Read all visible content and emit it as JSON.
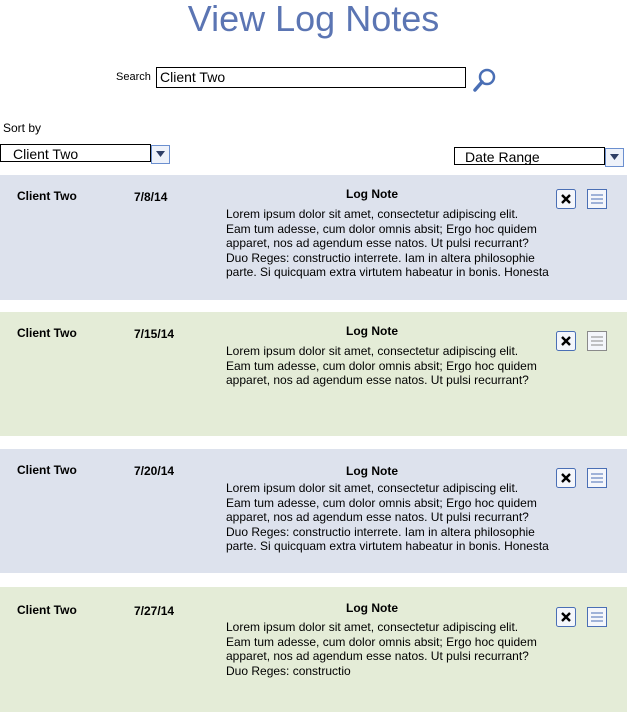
{
  "page": {
    "title": "View Log Notes"
  },
  "search": {
    "label": "Search",
    "value": "Client Two"
  },
  "sort": {
    "label": "Sort by",
    "selected": "Client Two"
  },
  "date_filter": {
    "selected": "Date Range"
  },
  "notes": [
    {
      "client": "Client Two",
      "date": "7/8/14",
      "heading": "Log Note",
      "lines": [
        "Lorem ipsum dolor sit amet, consectetur adipiscing elit.",
        "Eam tum adesse, cum dolor omnis absit; Ergo hoc quidem",
        "apparet, nos ad agendum esse natos. Ut pulsi recurrant?",
        "Duo Reges: constructio interrete. Iam in altera philosophie",
        "parte. Si quicquam extra virtutem habeatur in bonis. Honesta"
      ]
    },
    {
      "client": "Client Two",
      "date": "7/15/14",
      "heading": "Log Note",
      "lines": [
        "Lorem ipsum dolor sit amet, consectetur adipiscing elit.",
        "Eam tum adesse, cum dolor omnis absit; Ergo hoc quidem",
        "apparet, nos ad agendum esse natos. Ut pulsi recurrant?"
      ]
    },
    {
      "client": "Client Two",
      "date": "7/20/14",
      "heading": "Log Note",
      "lines": [
        "Lorem ipsum dolor sit amet, consectetur adipiscing elit.",
        "Eam tum adesse, cum dolor omnis absit; Ergo hoc quidem",
        "apparet, nos ad agendum esse natos. Ut pulsi recurrant?",
        "Duo Reges: constructio interrete. Iam in altera philosophie",
        "parte. Si quicquam extra virtutem habeatur in bonis. Honesta"
      ]
    },
    {
      "client": "Client Two",
      "date": "7/27/14",
      "heading": "Log Note",
      "lines": [
        "Lorem ipsum dolor sit amet, consectetur adipiscing elit.",
        "Eam tum adesse, cum dolor omnis absit; Ergo hoc quidem",
        "apparet, nos ad agendum esse natos. Ut pulsi recurrant?",
        "Duo Reges: constructio"
      ]
    }
  ],
  "colors": {
    "title": "#5b75b3",
    "card_blue": "#dde2ed",
    "card_green": "#e4ecd7",
    "icon_blue": "#4a6fb5"
  },
  "icons": {
    "search": "magnifier-icon",
    "delete": "close-icon",
    "view": "document-lines-icon",
    "dropdown": "chevron-down-icon"
  }
}
